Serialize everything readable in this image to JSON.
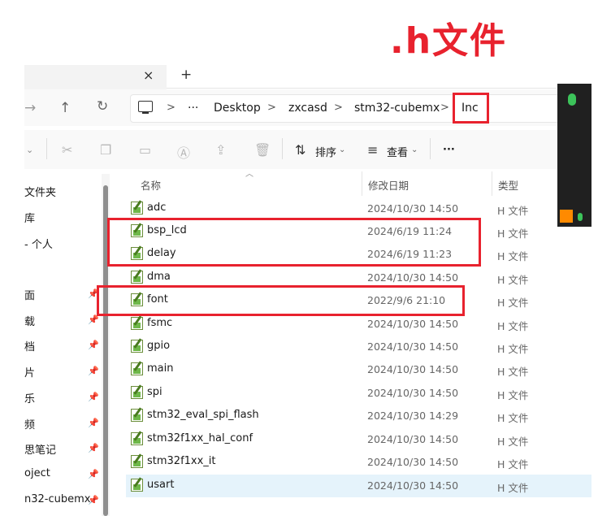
{
  "annotation": {
    "text": ".h文件",
    "color": "#e8222e"
  },
  "tabs": {
    "close": "×",
    "new": "+"
  },
  "address": {
    "more": "···",
    "crumbs": [
      "Desktop",
      "zxcasd",
      "stm32-cubemx",
      "Inc"
    ],
    "separator": ">"
  },
  "toolbar": {
    "sort_label": "排序",
    "view_label": "查看",
    "more": "···"
  },
  "sidebar": {
    "items": [
      {
        "label": "文件夹",
        "pinned": false
      },
      {
        "label": "库",
        "pinned": false
      },
      {
        "label": "- 个人",
        "pinned": false
      },
      {
        "label": "面",
        "pinned": true
      },
      {
        "label": "载",
        "pinned": true
      },
      {
        "label": "档",
        "pinned": true
      },
      {
        "label": "片",
        "pinned": true
      },
      {
        "label": "乐",
        "pinned": true
      },
      {
        "label": "频",
        "pinned": true
      },
      {
        "label": "思笔记",
        "pinned": true
      },
      {
        "label": "oject",
        "pinned": true
      },
      {
        "label": "n32-cubemx",
        "pinned": true
      }
    ]
  },
  "columns": {
    "name": "名称",
    "date": "修改日期",
    "type": "类型"
  },
  "files": [
    {
      "name": "adc",
      "date": "2024/10/30 14:50",
      "type": "H 文件"
    },
    {
      "name": "bsp_lcd",
      "date": "2024/6/19 11:24",
      "type": "H 文件"
    },
    {
      "name": "delay",
      "date": "2024/6/19 11:23",
      "type": "H 文件"
    },
    {
      "name": "dma",
      "date": "2024/10/30 14:50",
      "type": "H 文件"
    },
    {
      "name": "font",
      "date": "2022/9/6 21:10",
      "type": "H 文件"
    },
    {
      "name": "fsmc",
      "date": "2024/10/30 14:50",
      "type": "H 文件"
    },
    {
      "name": "gpio",
      "date": "2024/10/30 14:50",
      "type": "H 文件"
    },
    {
      "name": "main",
      "date": "2024/10/30 14:50",
      "type": "H 文件"
    },
    {
      "name": "spi",
      "date": "2024/10/30 14:50",
      "type": "H 文件"
    },
    {
      "name": "stm32_eval_spi_flash",
      "date": "2024/10/30 14:29",
      "type": "H 文件"
    },
    {
      "name": "stm32f1xx_hal_conf",
      "date": "2024/10/30 14:50",
      "type": "H 文件"
    },
    {
      "name": "stm32f1xx_it",
      "date": "2024/10/30 14:50",
      "type": "H 文件"
    },
    {
      "name": "usart",
      "date": "2024/10/30 14:50",
      "type": "H 文件"
    }
  ],
  "selected_file": "usart",
  "icons": {
    "forward": "forward-arrow-icon",
    "up": "up-arrow-icon",
    "refresh": "refresh-icon",
    "pc": "this-pc-icon",
    "file": "h-file-icon",
    "mic": "microphone-icon"
  }
}
